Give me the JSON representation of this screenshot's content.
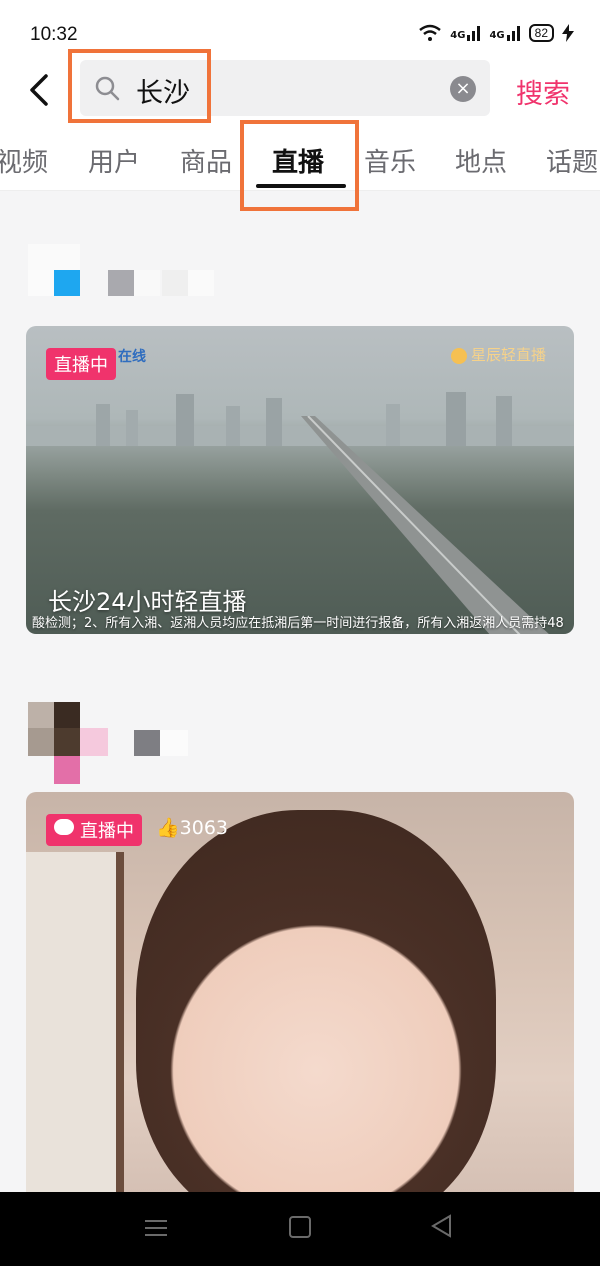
{
  "status_bar": {
    "time": "10:32",
    "signal1": "4G",
    "signal2": "4G",
    "battery": "82"
  },
  "search": {
    "query": "长沙",
    "button_label": "搜索"
  },
  "tabs": [
    {
      "label": "视频",
      "active": false
    },
    {
      "label": "用户",
      "active": false
    },
    {
      "label": "商品",
      "active": false
    },
    {
      "label": "直播",
      "active": true
    },
    {
      "label": "音乐",
      "active": false
    },
    {
      "label": "地点",
      "active": false
    },
    {
      "label": "话题",
      "active": false
    }
  ],
  "results": [
    {
      "badge": "直播中",
      "brand": "星辰轻直播",
      "channel_logo": "在线",
      "title": "长沙24小时轻直播",
      "ticker": "酸检测；2、所有入湘、返湘人员均应在抵湘后第一时间进行报备，所有入湘返湘人员需持48"
    },
    {
      "badge": "直播中",
      "likes": "3063"
    }
  ],
  "colors": {
    "accent": "#f0336c",
    "highlight_box": "#f0733a"
  }
}
